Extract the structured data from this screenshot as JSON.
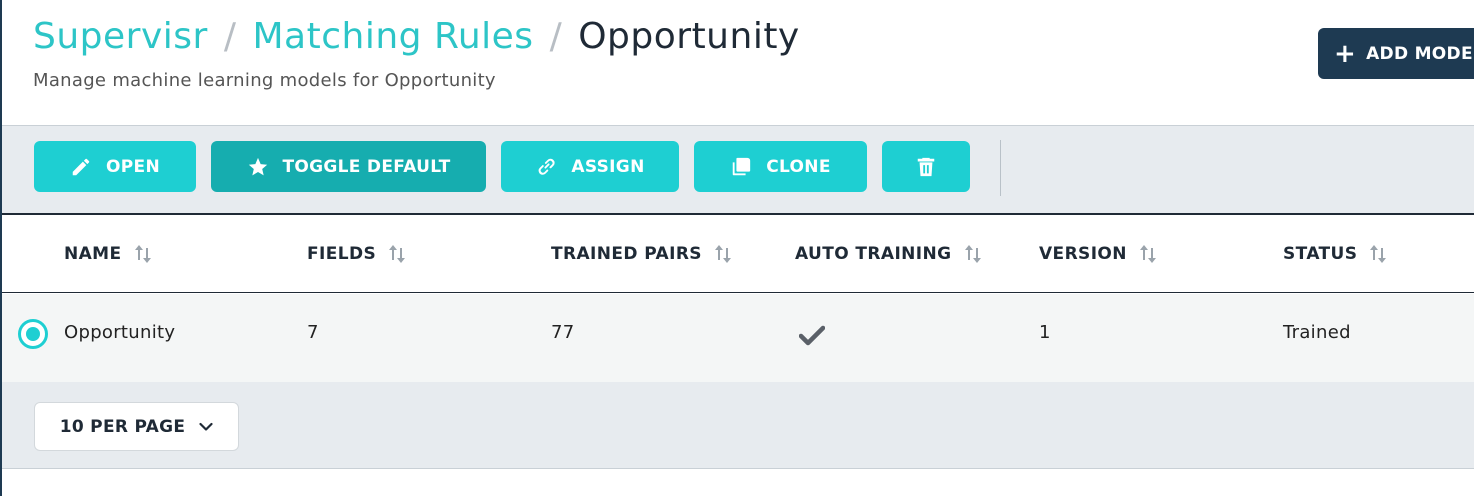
{
  "header": {
    "breadcrumb": [
      {
        "label": "Supervisr"
      },
      {
        "label": "Matching Rules"
      }
    ],
    "current": "Opportunity",
    "separator": "/",
    "subtitle": "Manage machine learning models for Opportunity",
    "add_button": "ADD MODEL"
  },
  "toolbar": {
    "open": "OPEN",
    "toggle_default": "TOGGLE DEFAULT",
    "assign": "ASSIGN",
    "clone": "CLONE"
  },
  "table": {
    "columns": [
      "NAME",
      "FIELDS",
      "TRAINED PAIRS",
      "AUTO TRAINING",
      "VERSION",
      "STATUS"
    ],
    "rows": [
      {
        "name": "Opportunity",
        "fields": "7",
        "trained_pairs": "77",
        "auto_training": true,
        "version": "1",
        "status": "Trained",
        "selected": true
      }
    ]
  },
  "pagination": {
    "per_page_label": "10 PER PAGE"
  },
  "colors": {
    "accent": "#1ecfd2",
    "accent_active": "#16adaf",
    "navy": "#1e3a52",
    "breadcrumb_link": "#2dc5c7"
  }
}
